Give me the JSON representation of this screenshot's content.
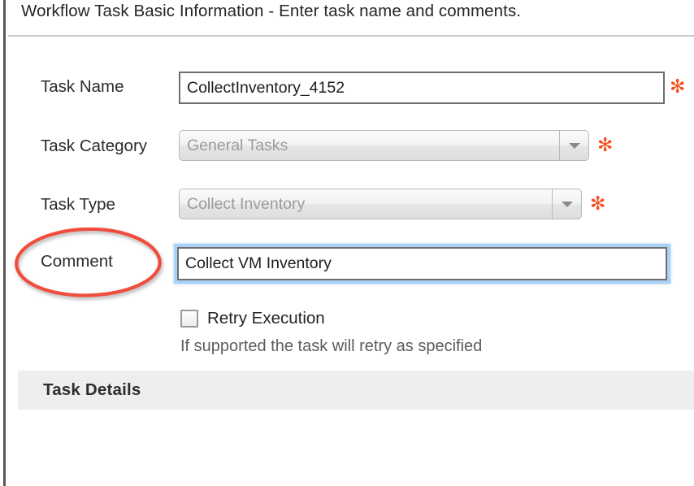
{
  "panel": {
    "title": "Workflow Task Basic Information - Enter task name and comments."
  },
  "form": {
    "fields": [
      {
        "label": "Task Name",
        "type": "text",
        "value": "CollectInventory_4152",
        "placeholder": "",
        "required": true,
        "required_marker": "✻"
      },
      {
        "label": "Task Category",
        "type": "dropdown",
        "value": "General Tasks",
        "required": true,
        "required_marker": "✻",
        "caret_icon": "chevron-down-icon"
      },
      {
        "label": "Task Type",
        "type": "dropdown",
        "value": "Collect Inventory",
        "required": true,
        "required_marker": "✻",
        "caret_icon": "chevron-down-icon"
      },
      {
        "label": "Comment",
        "type": "text",
        "value": "Collect VM Inventory",
        "placeholder": "",
        "required": false,
        "focused": true
      }
    ],
    "checkbox": {
      "label": "Retry Execution",
      "checked": false,
      "help_text": "If supported the task will retry as specified"
    }
  },
  "section": {
    "title": "Task Details"
  },
  "annotation": {
    "shape": "ellipse",
    "color": "#ef4d3e",
    "targets": "Comment"
  },
  "colors": {
    "required_asterisk": "#f4501e",
    "annotation_red": "#ef4d3e",
    "focus_glow": "#a9d0f5",
    "section_bar_bg": "#eeeeee",
    "rail": "#585858",
    "rule": "#c9c9c9"
  }
}
